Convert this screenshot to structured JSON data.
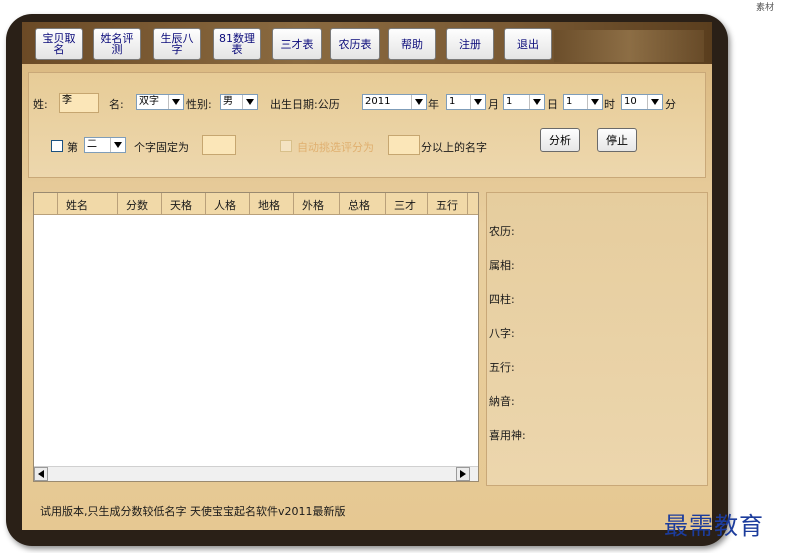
{
  "toolbar": {
    "buttons": [
      {
        "label": "宝贝取\n名"
      },
      {
        "label": "姓名评\n测"
      },
      {
        "label": "生辰八\n字"
      },
      {
        "label": "81数理\n表"
      },
      {
        "label": "三才表"
      },
      {
        "label": "农历表"
      },
      {
        "label": "帮助"
      },
      {
        "label": "注册"
      },
      {
        "label": "退出"
      }
    ]
  },
  "form": {
    "surname_label": "姓:",
    "surname_value": "李",
    "name_label": "名:",
    "name_type": "双字",
    "gender_label": "性别:",
    "gender_value": "男",
    "birth_label": "出生日期:公历",
    "year": "2011",
    "year_unit": "年",
    "month": "1",
    "month_unit": "月",
    "day": "1",
    "day_unit": "日",
    "hour": "1",
    "hour_unit": "时",
    "minute": "10",
    "minute_unit": "分",
    "fix_prefix": "第",
    "fix_position": "二",
    "fix_suffix": "个字固定为",
    "fix_value": "",
    "auto_pick_label": "自动挑选评分为",
    "auto_pick_value": "",
    "auto_pick_suffix": "分以上的名字",
    "analyze_button": "分析",
    "stop_button": "停止"
  },
  "table": {
    "columns": [
      "姓名",
      "分数",
      "天格",
      "人格",
      "地格",
      "外格",
      "总格",
      "三才",
      "五行"
    ],
    "rows": []
  },
  "info": {
    "fields": [
      {
        "label": "农历:",
        "value": ""
      },
      {
        "label": "属相:",
        "value": ""
      },
      {
        "label": "四柱:",
        "value": ""
      },
      {
        "label": "八字:",
        "value": ""
      },
      {
        "label": "五行:",
        "value": ""
      },
      {
        "label": "納音:",
        "value": ""
      },
      {
        "label": "喜用神:",
        "value": ""
      }
    ]
  },
  "status": "试用版本,只生成分数较低名字  天使宝宝起名软件v2011最新版",
  "brand": "最需教育",
  "corner_text": "素材"
}
